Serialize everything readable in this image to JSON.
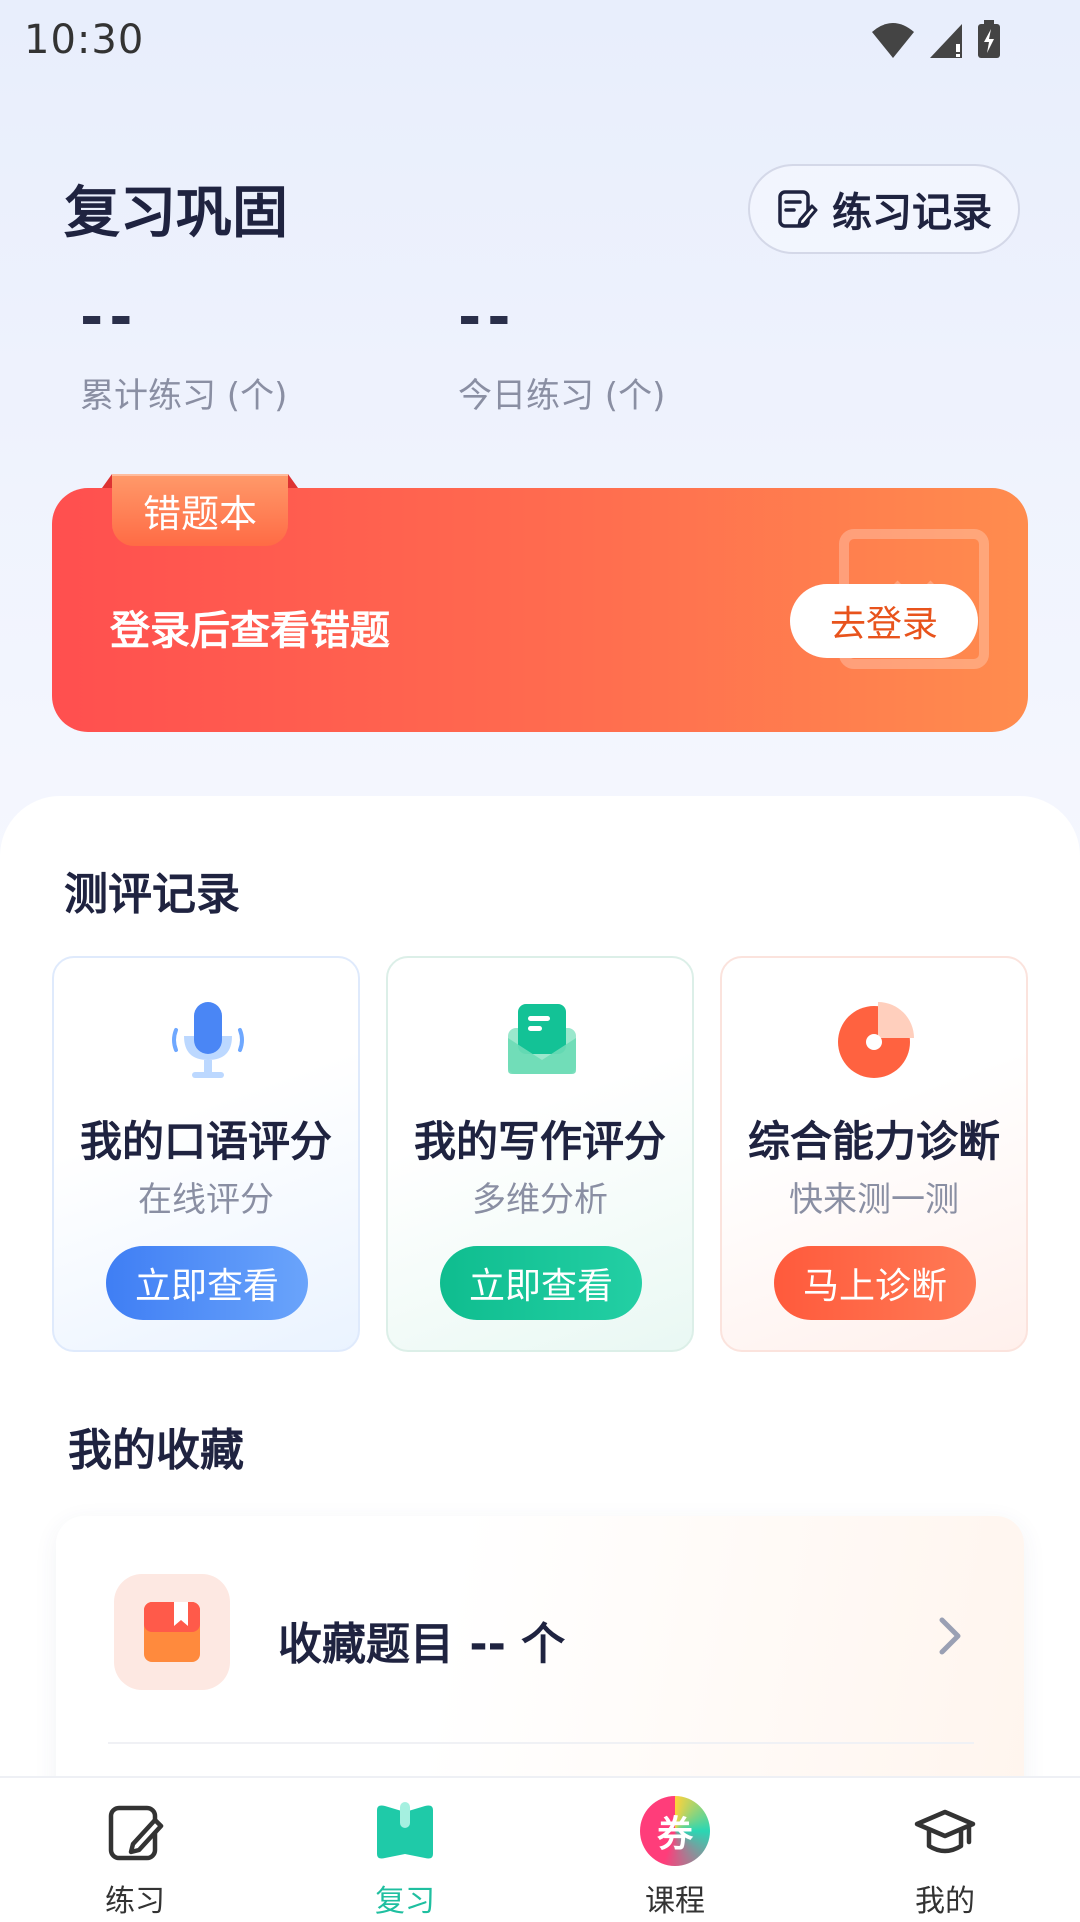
{
  "status_bar": {
    "time": "10:30"
  },
  "header": {
    "title": "复习巩固",
    "record_button": "练习记录"
  },
  "stats": [
    {
      "value": "--",
      "label": "累计练习 (个)"
    },
    {
      "value": "--",
      "label": "今日练习 (个)"
    }
  ],
  "error_book": {
    "tag": "错题本",
    "message": "登录后查看错题",
    "login_button": "去登录"
  },
  "evaluation": {
    "title": "测评记录",
    "cards": [
      {
        "title": "我的口语评分",
        "subtitle": "在线评分",
        "button": "立即查看",
        "color": "#4a86f5",
        "icon": "microphone-icon"
      },
      {
        "title": "我的写作评分",
        "subtitle": "多维分析",
        "button": "立即查看",
        "color": "#13c296",
        "icon": "envelope-icon"
      },
      {
        "title": "综合能力诊断",
        "subtitle": "快来测一测",
        "button": "马上诊断",
        "color": "#ff6240",
        "icon": "pie-chart-icon"
      }
    ]
  },
  "favorites": {
    "title": "我的收藏",
    "item_label": "收藏题目 -- 个"
  },
  "bottom_nav": [
    {
      "label": "练习",
      "icon": "practice-icon",
      "active": false
    },
    {
      "label": "复习",
      "icon": "review-book-icon",
      "active": true
    },
    {
      "label": "课程",
      "icon": "coupon-icon",
      "active": false,
      "badge_text": "券"
    },
    {
      "label": "我的",
      "icon": "graduation-cap-icon",
      "active": false
    }
  ]
}
